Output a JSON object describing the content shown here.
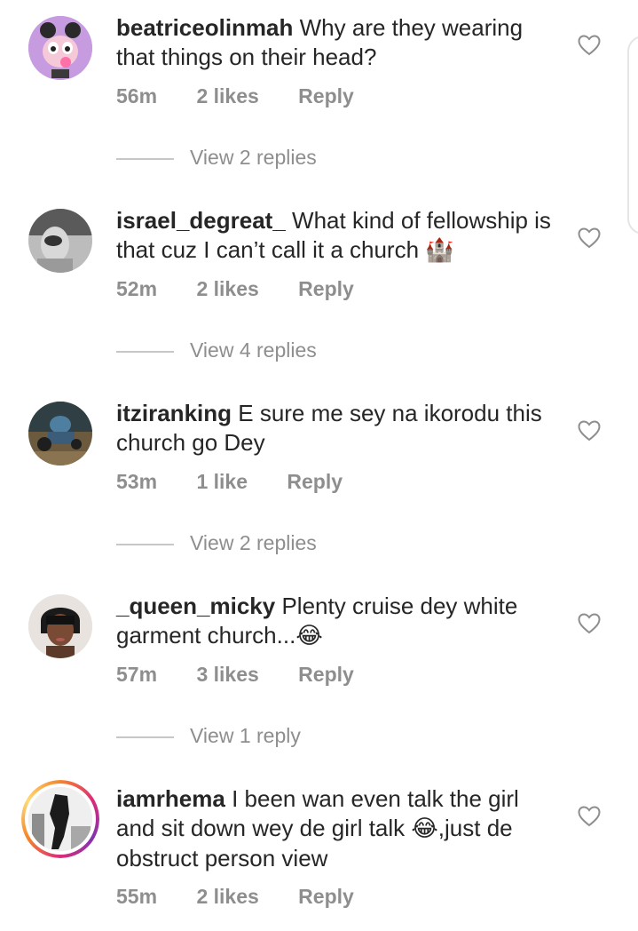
{
  "comments": [
    {
      "username": "beatriceolinmah",
      "text": "Why are they wearing that things on their head?",
      "emoji": "",
      "text_after": "",
      "time": "56m",
      "likes": "2 likes",
      "reply": "Reply",
      "view_replies": "View 2 replies"
    },
    {
      "username": "israel_degreat_",
      "text": "What kind of fellowship is that cuz I can’t call it a church",
      "emoji": "🏰",
      "text_after": "",
      "time": "52m",
      "likes": "2 likes",
      "reply": "Reply",
      "view_replies": "View 4 replies"
    },
    {
      "username": "itziranking",
      "text": "E sure me sey na ikorodu this church go Dey",
      "emoji": "",
      "text_after": "",
      "time": "53m",
      "likes": "1 like",
      "reply": "Reply",
      "view_replies": "View 2 replies"
    },
    {
      "username": "_queen_micky",
      "text": "Plenty cruise dey white garment church...",
      "emoji": "😂",
      "text_after": "",
      "time": "57m",
      "likes": "3 likes",
      "reply": "Reply",
      "view_replies": "View 1 reply"
    },
    {
      "username": "iamrhema",
      "text": "I been wan even talk the girl and sit down wey de girl talk",
      "emoji": "😂",
      "text_after": ",just de obstruct person view",
      "time": "55m",
      "likes": "2 likes",
      "reply": "Reply",
      "view_replies": ""
    }
  ],
  "icons": {
    "like": "heart-outline-icon"
  },
  "colors": {
    "text": "#262626",
    "muted": "#8e8e8e",
    "divider": "#c7c7c7"
  }
}
